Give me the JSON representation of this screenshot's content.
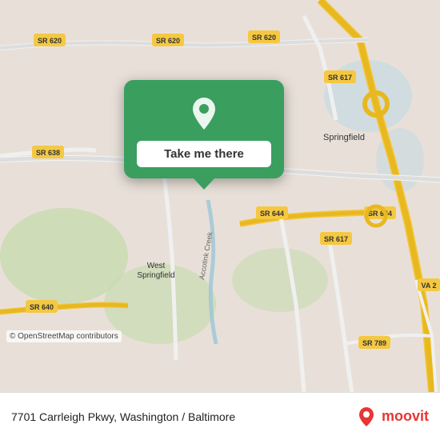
{
  "map": {
    "background_color": "#e8e0d8",
    "center_lat": 38.77,
    "center_lng": -77.19
  },
  "popup": {
    "button_label": "Take me there",
    "pin_color": "white",
    "bg_color": "#3a9e5f"
  },
  "bottom_bar": {
    "address": "7701 Carrleigh Pkwy, Washington / Baltimore",
    "osm_credit": "© OpenStreetMap contributors",
    "moovit_label": "moovit"
  },
  "labels": {
    "sr620": "SR 620",
    "sr617": "SR 617",
    "sr638": "SR 638",
    "sr644_left": "SR 644",
    "sr644_right": "SR 644",
    "sr640": "SR 640",
    "sr617b": "SR 617",
    "sr789": "SR 789",
    "va2": "VA 2",
    "springfield": "Springfield",
    "west_springfield": "West\nSpringfield",
    "accotink": "Accotink Creek"
  }
}
